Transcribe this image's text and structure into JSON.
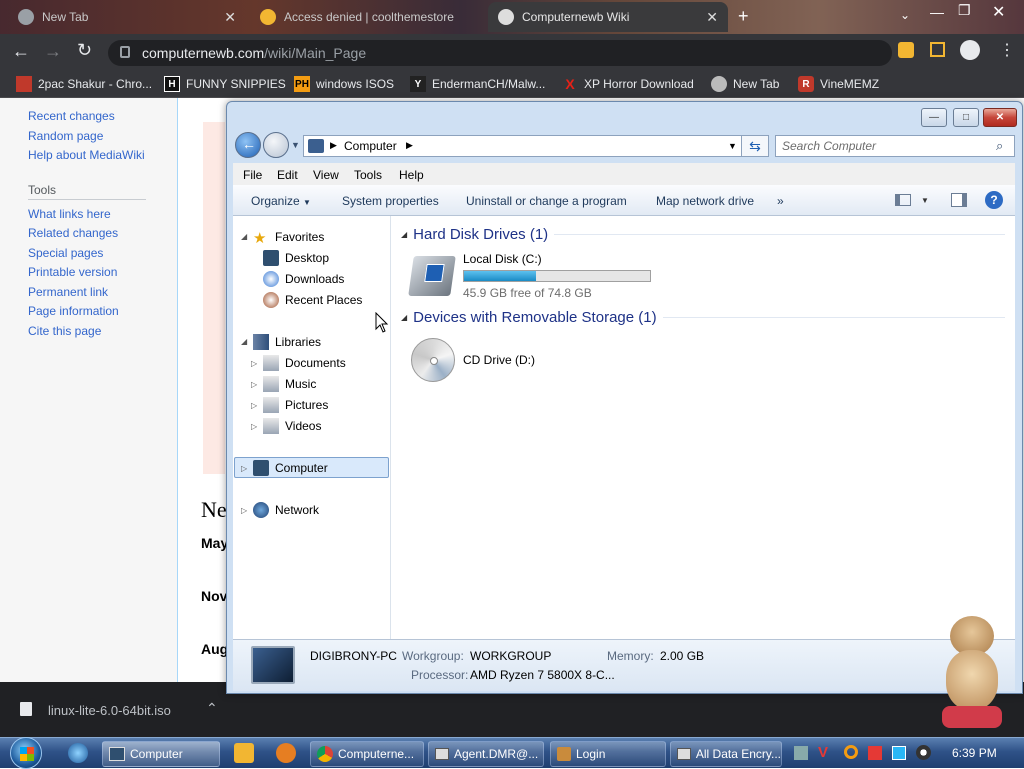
{
  "browser": {
    "tabs": [
      {
        "title": "New Tab"
      },
      {
        "title": "Access denied | coolthemestores"
      },
      {
        "title": "Computernewb Wiki"
      }
    ],
    "url_domain": "computernewb.com",
    "url_path": "/wiki/Main_Page",
    "bookmarks": [
      {
        "label": "2pac Shakur - Chro..."
      },
      {
        "label": "FUNNY SNIPPIES"
      },
      {
        "label": "windows ISOS"
      },
      {
        "label": "EndermanCH/Malw..."
      },
      {
        "label": "XP Horror Download"
      },
      {
        "label": "New Tab"
      },
      {
        "label": "VineMEMZ"
      }
    ]
  },
  "wiki": {
    "sidebar_links": [
      "Recent changes",
      "Random page",
      "Help about MediaWiki"
    ],
    "tools_heading": "Tools",
    "tools_links": [
      "What links here",
      "Related changes",
      "Special pages",
      "Printable version",
      "Permanent link",
      "Page information",
      "Cite this page"
    ],
    "content_heading": "Ne",
    "content_items": [
      "May",
      "Nov",
      "Aug"
    ]
  },
  "download": {
    "filename": "linux-lite-6.0-64bit.iso"
  },
  "explorer": {
    "breadcrumb": "Computer",
    "search_placeholder": "Search Computer",
    "menu": [
      "File",
      "Edit",
      "View",
      "Tools",
      "Help"
    ],
    "commands": [
      "Organize",
      "System properties",
      "Uninstall or change a program",
      "Map network drive",
      "»"
    ],
    "nav": {
      "favorites": "Favorites",
      "favorites_items": [
        "Desktop",
        "Downloads",
        "Recent Places"
      ],
      "libraries": "Libraries",
      "libraries_items": [
        "Documents",
        "Music",
        "Pictures",
        "Videos"
      ],
      "computer": "Computer",
      "network": "Network"
    },
    "groups": {
      "hdd_header": "Hard Disk Drives (1)",
      "removable_header": "Devices with Removable Storage (1)"
    },
    "drive_c": {
      "name": "Local Disk (C:)",
      "free_text": "45.9 GB free of 74.8 GB",
      "used_fraction": 0.386
    },
    "drive_d": {
      "name": "CD Drive (D:)"
    },
    "details": {
      "pc_name": "DIGIBRONY-PC",
      "workgroup_label": "Workgroup:",
      "workgroup": "WORKGROUP",
      "memory_label": "Memory:",
      "memory": "2.00 GB",
      "processor_label": "Processor:",
      "processor": "AMD Ryzen 7 5800X 8-C..."
    }
  },
  "taskbar": {
    "items": [
      "Computer",
      "Computerne...",
      "Agent.DMR@...",
      "Login",
      "All Data Encry..."
    ],
    "clock": "6:39 PM"
  },
  "colors": {
    "accent": "#1e3287",
    "link": "#3366cc",
    "disk_bar": "#26a0da"
  }
}
